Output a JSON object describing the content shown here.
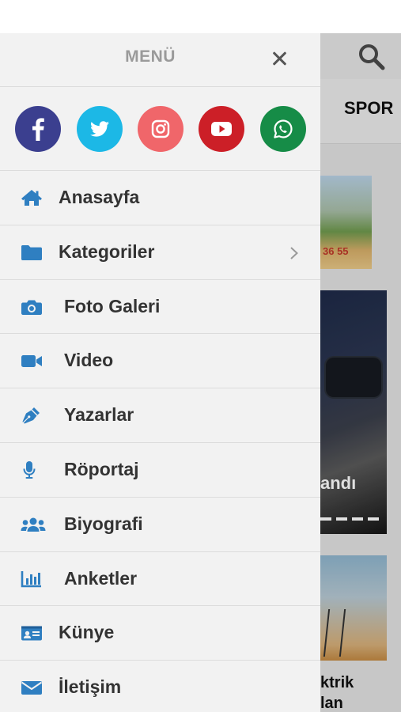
{
  "background": {
    "nav_label": "SPOR",
    "ad_text": "36 55",
    "photo1_caption": "andı",
    "photo2_caption_line1": "ktrik",
    "photo2_caption_line2": "lan"
  },
  "drawer": {
    "title": "MENÜ",
    "close_icon": "close-icon",
    "social": [
      {
        "name": "facebook",
        "color": "#3b3f8f",
        "icon": "facebook-icon"
      },
      {
        "name": "twitter",
        "color": "#1cb8e6",
        "icon": "twitter-icon"
      },
      {
        "name": "instagram",
        "color": "#f0666a",
        "icon": "instagram-icon"
      },
      {
        "name": "youtube",
        "color": "#cc1f27",
        "icon": "youtube-icon"
      },
      {
        "name": "whatsapp",
        "color": "#168c47",
        "icon": "whatsapp-icon"
      }
    ],
    "items": [
      {
        "label": "Anasayfa",
        "icon": "home-icon"
      },
      {
        "label": "Kategoriler",
        "icon": "folder-icon",
        "has_submenu": true
      },
      {
        "label": "Foto Galeri",
        "icon": "camera-icon"
      },
      {
        "label": "Video",
        "icon": "video-camera-icon"
      },
      {
        "label": "Yazarlar",
        "icon": "pen-nib-icon"
      },
      {
        "label": "Röportaj",
        "icon": "microphone-icon"
      },
      {
        "label": "Biyografi",
        "icon": "users-icon"
      },
      {
        "label": "Anketler",
        "icon": "bar-chart-icon"
      },
      {
        "label": "Künye",
        "icon": "id-card-icon"
      },
      {
        "label": "İletişim",
        "icon": "envelope-icon"
      }
    ],
    "icon_color": "#2f7fc1"
  }
}
